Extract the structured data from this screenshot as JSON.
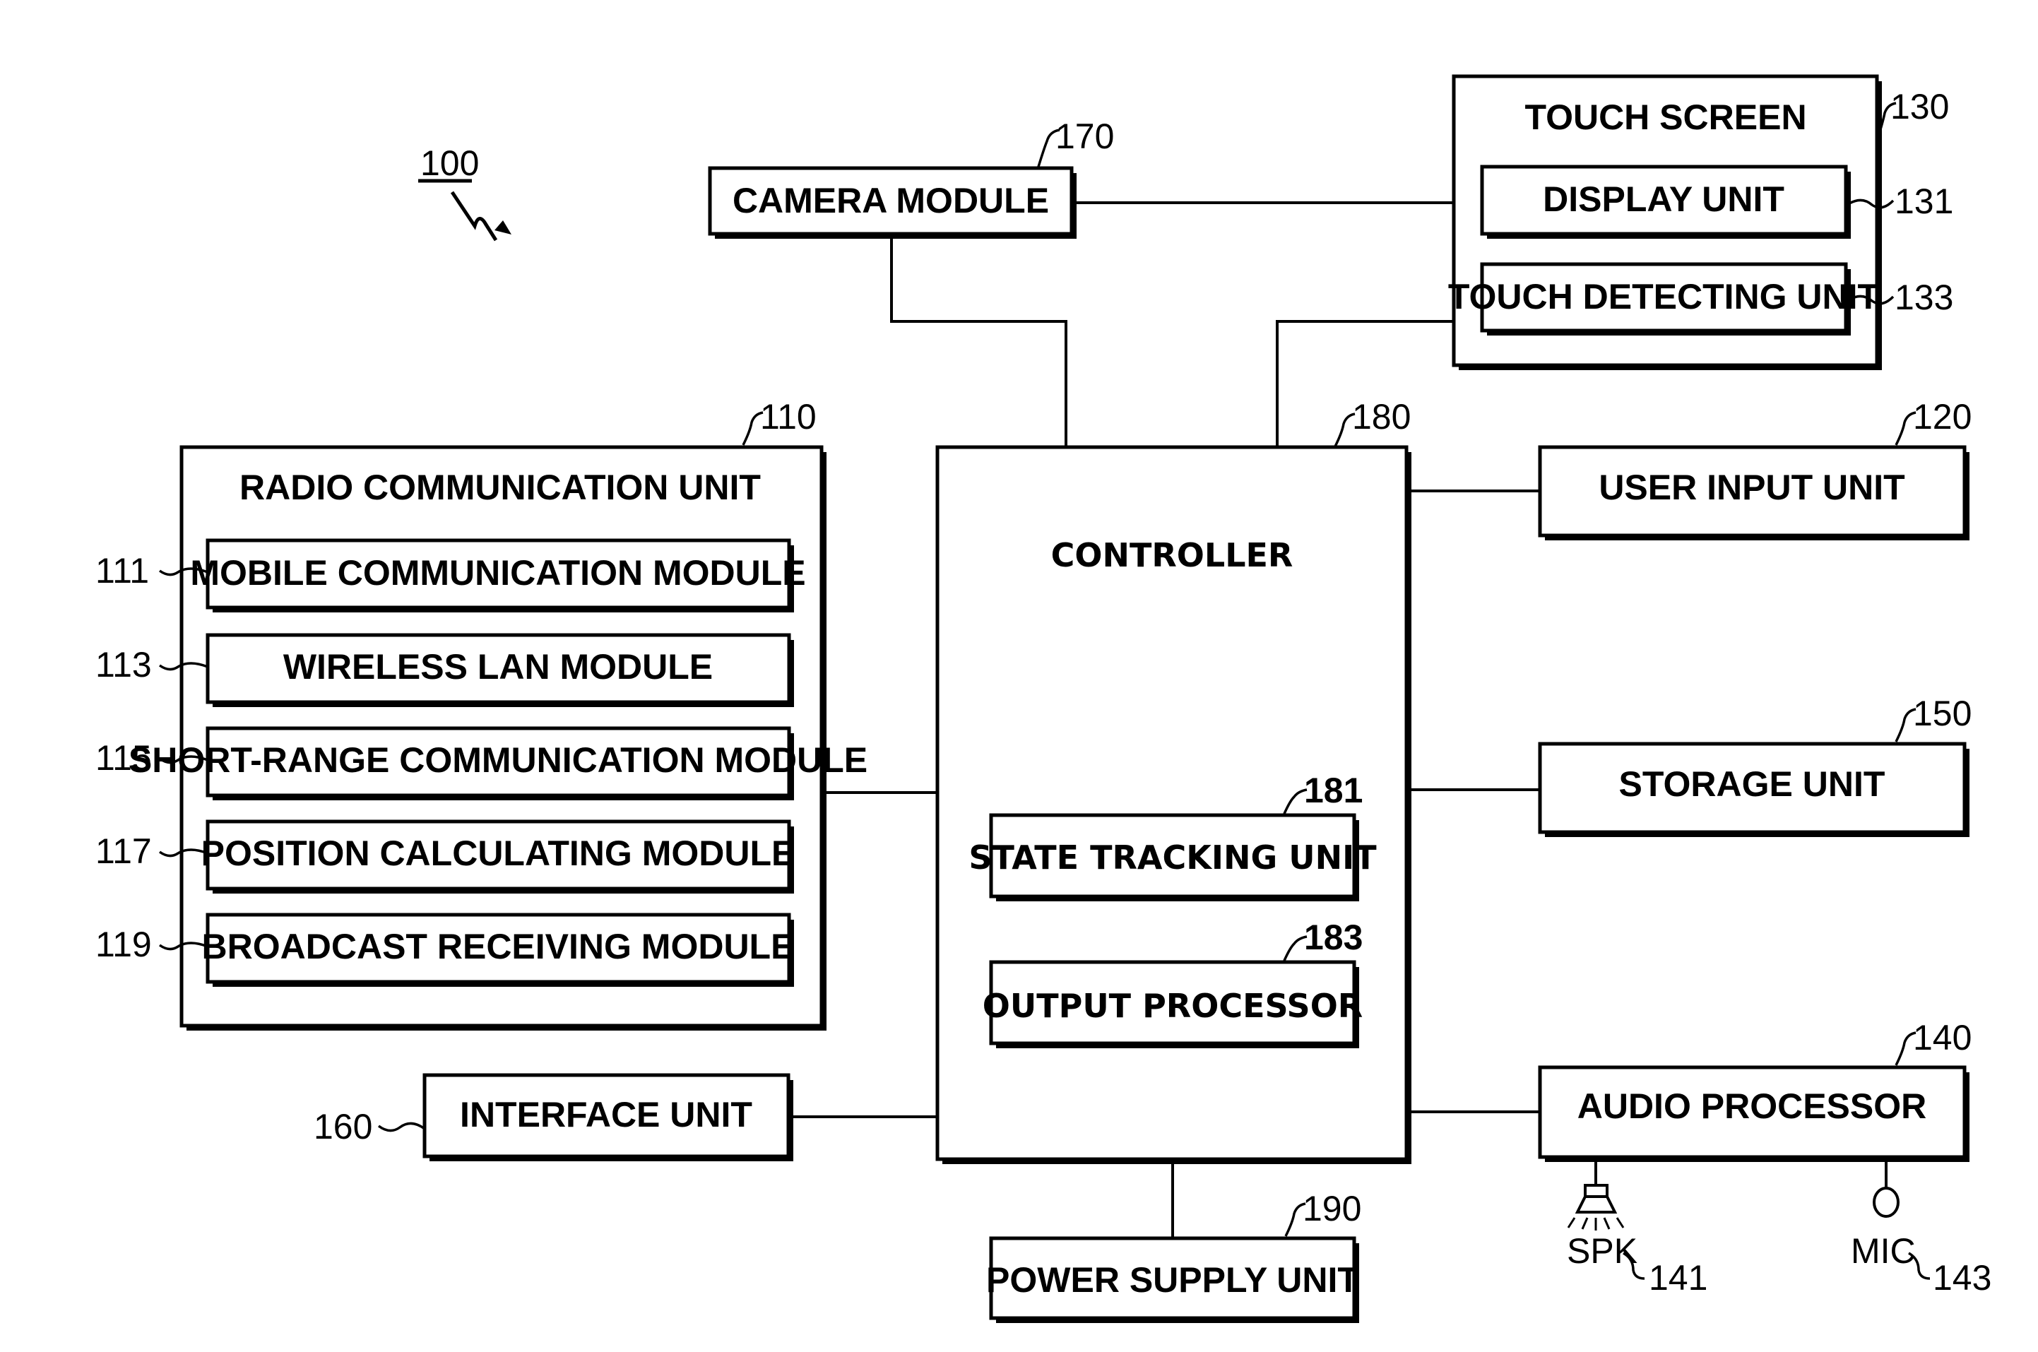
{
  "figure": {
    "device_ref": "100",
    "colors": {
      "line": "#000000",
      "background": "#ffffff"
    }
  },
  "blocks": {
    "camera": {
      "label": "CAMERA MODULE",
      "ref": "170"
    },
    "touch_screen": {
      "label": "TOUCH SCREEN",
      "ref": "130",
      "display_unit": {
        "label": "DISPLAY UNIT",
        "ref": "131"
      },
      "touch_detecting_unit": {
        "label": "TOUCH DETECTING UNIT",
        "ref": "133"
      }
    },
    "radio": {
      "label": "RADIO COMMUNICATION UNIT",
      "ref": "110",
      "modules": [
        {
          "label": "MOBILE COMMUNICATION MODULE",
          "ref": "111"
        },
        {
          "label": "WIRELESS LAN MODULE",
          "ref": "113"
        },
        {
          "label": "SHORT-RANGE COMMUNICATION MODULE",
          "ref": "115"
        },
        {
          "label": "POSITION CALCULATING MODULE",
          "ref": "117"
        },
        {
          "label": "BROADCAST RECEIVING MODULE",
          "ref": "119"
        }
      ]
    },
    "controller": {
      "label": "CONTROLLER",
      "ref": "180",
      "state_tracking": {
        "label": "STATE TRACKING UNIT",
        "ref": "181"
      },
      "output_processor": {
        "label": "OUTPUT PROCESSOR",
        "ref": "183"
      }
    },
    "user_input": {
      "label": "USER INPUT UNIT",
      "ref": "120"
    },
    "storage": {
      "label": "STORAGE UNIT",
      "ref": "150"
    },
    "audio": {
      "label": "AUDIO PROCESSOR",
      "ref": "140",
      "speaker": {
        "label": "SPK",
        "ref": "141"
      },
      "mic": {
        "label": "MIC",
        "ref": "143"
      }
    },
    "interface": {
      "label": "INTERFACE UNIT",
      "ref": "160"
    },
    "power": {
      "label": "POWER SUPPLY UNIT",
      "ref": "190"
    }
  }
}
